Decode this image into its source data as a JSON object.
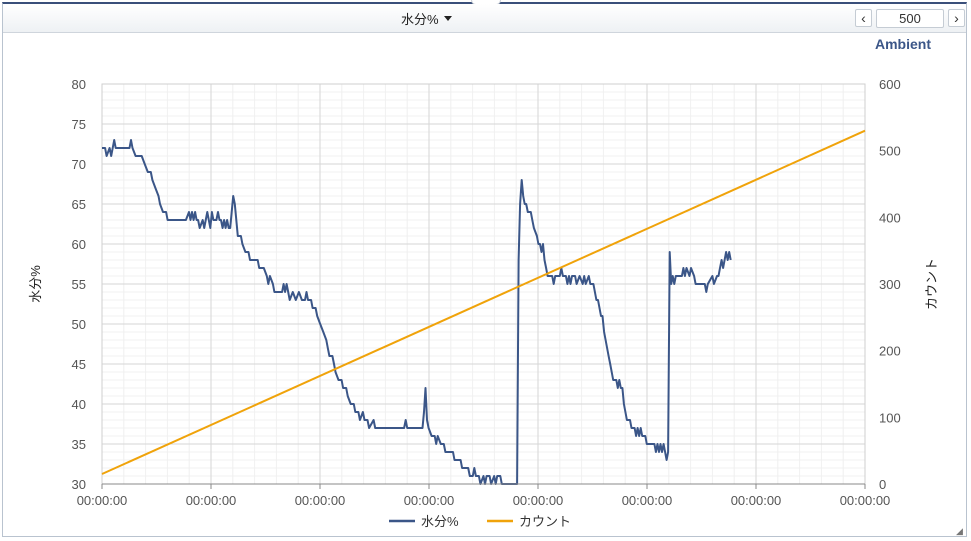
{
  "toolbar": {
    "dropdown_label": "水分%",
    "prev_glyph": "‹",
    "count_value": "500"
  },
  "chart_data": {
    "type": "line",
    "title": "Ambient",
    "xlabel": "",
    "ylabel_left": "水分%",
    "ylabel_right": "カウント",
    "ylim_left": [
      30,
      80
    ],
    "ylim_right": [
      0,
      600
    ],
    "yticks_left": [
      "30",
      "35",
      "40",
      "45",
      "50",
      "55",
      "60",
      "65",
      "70",
      "75",
      "80"
    ],
    "yticks_right": [
      "0",
      "100",
      "200",
      "300",
      "400",
      "500",
      "600"
    ],
    "xticks": [
      "00:00:00",
      "00:00:00",
      "00:00:00",
      "00:00:00",
      "00:00:00",
      "00:00:00",
      "00:00:00",
      "00:00:00"
    ],
    "xlim": [
      0,
      500
    ],
    "grid": true,
    "legend_position": "bottom",
    "series": [
      {
        "name": "水分%",
        "axis": "left",
        "color": "#3b5688",
        "points": [
          [
            0,
            72
          ],
          [
            2,
            72
          ],
          [
            3,
            71
          ],
          [
            5,
            72
          ],
          [
            6,
            71
          ],
          [
            7,
            72
          ],
          [
            8,
            73
          ],
          [
            9,
            72
          ],
          [
            12,
            72
          ],
          [
            16,
            72
          ],
          [
            18,
            72
          ],
          [
            19,
            73
          ],
          [
            20,
            72
          ],
          [
            22,
            71
          ],
          [
            26,
            71
          ],
          [
            28,
            70
          ],
          [
            30,
            69
          ],
          [
            32,
            69
          ],
          [
            33,
            68
          ],
          [
            35,
            67
          ],
          [
            37,
            66
          ],
          [
            38,
            65
          ],
          [
            40,
            64
          ],
          [
            42,
            64
          ],
          [
            43,
            63
          ],
          [
            45,
            63
          ],
          [
            50,
            63
          ],
          [
            55,
            63
          ],
          [
            57,
            64
          ],
          [
            58,
            63
          ],
          [
            59,
            64
          ],
          [
            60,
            63
          ],
          [
            61,
            64
          ],
          [
            62,
            63
          ],
          [
            63,
            63
          ],
          [
            64,
            62
          ],
          [
            66,
            63
          ],
          [
            67,
            62
          ],
          [
            69,
            64
          ],
          [
            70,
            63
          ],
          [
            71,
            62
          ],
          [
            72,
            64
          ],
          [
            73,
            63
          ],
          [
            75,
            63
          ],
          [
            76,
            64
          ],
          [
            77,
            63
          ],
          [
            78,
            63
          ],
          [
            79,
            62
          ],
          [
            80,
            63
          ],
          [
            81,
            62
          ],
          [
            82,
            63
          ],
          [
            83,
            62
          ],
          [
            84,
            62
          ],
          [
            85,
            64
          ],
          [
            86,
            66
          ],
          [
            87,
            65
          ],
          [
            88,
            63
          ],
          [
            89,
            61
          ],
          [
            91,
            61
          ],
          [
            92,
            60
          ],
          [
            94,
            59
          ],
          [
            96,
            59
          ],
          [
            97,
            58
          ],
          [
            100,
            58
          ],
          [
            102,
            58
          ],
          [
            103,
            57
          ],
          [
            106,
            57
          ],
          [
            108,
            56
          ],
          [
            109,
            55
          ],
          [
            110,
            56
          ],
          [
            112,
            55
          ],
          [
            113,
            54
          ],
          [
            118,
            54
          ],
          [
            119,
            55
          ],
          [
            120,
            54
          ],
          [
            121,
            55
          ],
          [
            122,
            54
          ],
          [
            123,
            53
          ],
          [
            125,
            54
          ],
          [
            127,
            53
          ],
          [
            129,
            54
          ],
          [
            131,
            53
          ],
          [
            133,
            53
          ],
          [
            134,
            54
          ],
          [
            135,
            53
          ],
          [
            137,
            53
          ],
          [
            138,
            52
          ],
          [
            140,
            52
          ],
          [
            141,
            51
          ],
          [
            143,
            50
          ],
          [
            145,
            49
          ],
          [
            147,
            48
          ],
          [
            148,
            47
          ],
          [
            149,
            46
          ],
          [
            151,
            46
          ],
          [
            152,
            45
          ],
          [
            153,
            44
          ],
          [
            155,
            43
          ],
          [
            157,
            43
          ],
          [
            158,
            42
          ],
          [
            160,
            42
          ],
          [
            161,
            41
          ],
          [
            163,
            40
          ],
          [
            165,
            40
          ],
          [
            166,
            39
          ],
          [
            168,
            39
          ],
          [
            169,
            38
          ],
          [
            171,
            39
          ],
          [
            172,
            38
          ],
          [
            174,
            38
          ],
          [
            175,
            37
          ],
          [
            178,
            38
          ],
          [
            179,
            37
          ],
          [
            182,
            37
          ],
          [
            185,
            37
          ],
          [
            190,
            37
          ],
          [
            195,
            37
          ],
          [
            198,
            37
          ],
          [
            199,
            38
          ],
          [
            200,
            37
          ],
          [
            202,
            37
          ],
          [
            205,
            37
          ],
          [
            208,
            37
          ],
          [
            210,
            37
          ],
          [
            211,
            39
          ],
          [
            212,
            42
          ],
          [
            213,
            38
          ],
          [
            214,
            37
          ],
          [
            216,
            36
          ],
          [
            218,
            36
          ],
          [
            219,
            35
          ],
          [
            220,
            36
          ],
          [
            222,
            35
          ],
          [
            224,
            35
          ],
          [
            225,
            34
          ],
          [
            230,
            34
          ],
          [
            231,
            33
          ],
          [
            235,
            33
          ],
          [
            236,
            32
          ],
          [
            240,
            32
          ],
          [
            241,
            31
          ],
          [
            243,
            31
          ],
          [
            244,
            32
          ],
          [
            245,
            31
          ],
          [
            247,
            31
          ],
          [
            248,
            30
          ],
          [
            250,
            31
          ],
          [
            251,
            30
          ],
          [
            252,
            31
          ],
          [
            254,
            31
          ],
          [
            255,
            30
          ],
          [
            257,
            31
          ],
          [
            258,
            30
          ],
          [
            259,
            31
          ],
          [
            261,
            31
          ],
          [
            262,
            30
          ],
          [
            265,
            30
          ],
          [
            268,
            30
          ],
          [
            270,
            30
          ],
          [
            271,
            27
          ],
          [
            272,
            25
          ],
          [
            273,
            58
          ],
          [
            274,
            65
          ],
          [
            275,
            68
          ],
          [
            276,
            66
          ],
          [
            277,
            65
          ],
          [
            278,
            65
          ],
          [
            279,
            64
          ],
          [
            281,
            64
          ],
          [
            282,
            63
          ],
          [
            283,
            62
          ],
          [
            285,
            61
          ],
          [
            286,
            60
          ],
          [
            287,
            60
          ],
          [
            288,
            59
          ],
          [
            289,
            60
          ],
          [
            290,
            58
          ],
          [
            291,
            57
          ],
          [
            292,
            56
          ],
          [
            295,
            56
          ],
          [
            296,
            55
          ],
          [
            297,
            56
          ],
          [
            300,
            56
          ],
          [
            301,
            57
          ],
          [
            302,
            56
          ],
          [
            304,
            56
          ],
          [
            305,
            55
          ],
          [
            306,
            56
          ],
          [
            307,
            55
          ],
          [
            308,
            56
          ],
          [
            310,
            56
          ],
          [
            311,
            55
          ],
          [
            313,
            56
          ],
          [
            315,
            55
          ],
          [
            316,
            56
          ],
          [
            317,
            55
          ],
          [
            319,
            56
          ],
          [
            320,
            55
          ],
          [
            322,
            55
          ],
          [
            323,
            54
          ],
          [
            324,
            53
          ],
          [
            325,
            53
          ],
          [
            326,
            52
          ],
          [
            327,
            51
          ],
          [
            328,
            51
          ],
          [
            329,
            49
          ],
          [
            330,
            48
          ],
          [
            331,
            47
          ],
          [
            332,
            46
          ],
          [
            333,
            45
          ],
          [
            334,
            44
          ],
          [
            335,
            43
          ],
          [
            337,
            43
          ],
          [
            338,
            42
          ],
          [
            339,
            43
          ],
          [
            340,
            42
          ],
          [
            341,
            42
          ],
          [
            342,
            40
          ],
          [
            343,
            39
          ],
          [
            344,
            38
          ],
          [
            346,
            38
          ],
          [
            347,
            37
          ],
          [
            349,
            37
          ],
          [
            350,
            36
          ],
          [
            351,
            37
          ],
          [
            352,
            36
          ],
          [
            353,
            37
          ],
          [
            354,
            36
          ],
          [
            356,
            36
          ],
          [
            357,
            35
          ],
          [
            360,
            35
          ],
          [
            362,
            35
          ],
          [
            363,
            34
          ],
          [
            364,
            35
          ],
          [
            365,
            34
          ],
          [
            366,
            35
          ],
          [
            367,
            34
          ],
          [
            368,
            35
          ],
          [
            369,
            34
          ],
          [
            370,
            33
          ],
          [
            371,
            34
          ],
          [
            372,
            59
          ],
          [
            373,
            55
          ],
          [
            374,
            56
          ],
          [
            375,
            55
          ],
          [
            376,
            56
          ],
          [
            380,
            56
          ],
          [
            381,
            57
          ],
          [
            382,
            56
          ],
          [
            383,
            57
          ],
          [
            385,
            56
          ],
          [
            386,
            57
          ],
          [
            388,
            56
          ],
          [
            389,
            55
          ],
          [
            392,
            55
          ],
          [
            395,
            55
          ],
          [
            396,
            54
          ],
          [
            397,
            55
          ],
          [
            400,
            56
          ],
          [
            401,
            55
          ],
          [
            403,
            56
          ],
          [
            404,
            56
          ],
          [
            405,
            57
          ],
          [
            406,
            58
          ],
          [
            407,
            57
          ],
          [
            408,
            58
          ],
          [
            409,
            59
          ],
          [
            410,
            58
          ],
          [
            411,
            59
          ],
          [
            412,
            58
          ]
        ]
      },
      {
        "name": "カウント",
        "axis": "right",
        "color": "#f0a30a",
        "points": [
          [
            0,
            15
          ],
          [
            500,
            530
          ]
        ]
      }
    ]
  }
}
